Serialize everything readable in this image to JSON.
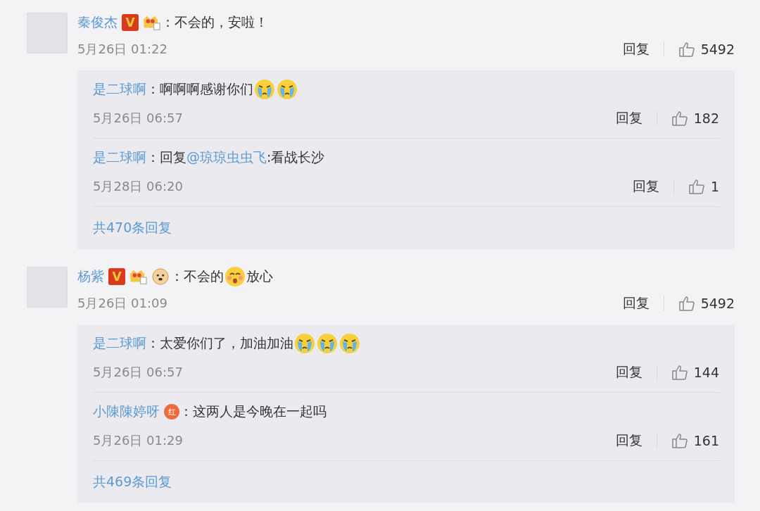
{
  "comments": [
    {
      "user": "秦俊杰",
      "badges": [
        {
          "kind": "verified",
          "text": "V"
        },
        {
          "kind": "member"
        }
      ],
      "content": [
        {
          "kind": "text",
          "text": "：不会的，安啦！"
        }
      ],
      "time": "5月26日 01:22",
      "reply_label": "回复",
      "likes": "5492",
      "replies": [
        {
          "user": "是二球啊",
          "content": [
            {
              "kind": "text",
              "text": "：啊啊啊感谢你们"
            },
            {
              "kind": "cry"
            },
            {
              "kind": "cry"
            }
          ],
          "time": "5月26日 06:57",
          "reply_label": "回复",
          "likes": "182"
        },
        {
          "user": "是二球啊",
          "content": [
            {
              "kind": "text",
              "text": "：回复"
            },
            {
              "kind": "mention",
              "text": "@琼琼虫虫飞"
            },
            {
              "kind": "text",
              "text": ":看战长沙"
            }
          ],
          "time": "5月28日 06:20",
          "reply_label": "回复",
          "likes": "1"
        }
      ],
      "more_replies": "共470条回复"
    },
    {
      "user": "杨紫",
      "badges": [
        {
          "kind": "verified",
          "text": "V"
        },
        {
          "kind": "member"
        },
        {
          "kind": "doge"
        }
      ],
      "content": [
        {
          "kind": "text",
          "text": "：不会的"
        },
        {
          "kind": "smile"
        },
        {
          "kind": "text",
          "text": "放心"
        }
      ],
      "time": "5月26日 01:09",
      "reply_label": "回复",
      "likes": "5492",
      "replies": [
        {
          "user": "是二球啊",
          "content": [
            {
              "kind": "text",
              "text": "：太爱你们了，加油加油"
            },
            {
              "kind": "cry"
            },
            {
              "kind": "cry"
            },
            {
              "kind": "cry"
            }
          ],
          "time": "5月26日 06:57",
          "reply_label": "回复",
          "likes": "144"
        },
        {
          "user": "小陳陳婷呀",
          "badges": [
            {
              "kind": "red",
              "text": "红"
            }
          ],
          "content": [
            {
              "kind": "text",
              "text": "：这两人是今晚在一起吗"
            }
          ],
          "time": "5月26日 01:29",
          "reply_label": "回复",
          "likes": "161"
        }
      ],
      "more_replies": "共469条回复"
    }
  ]
}
